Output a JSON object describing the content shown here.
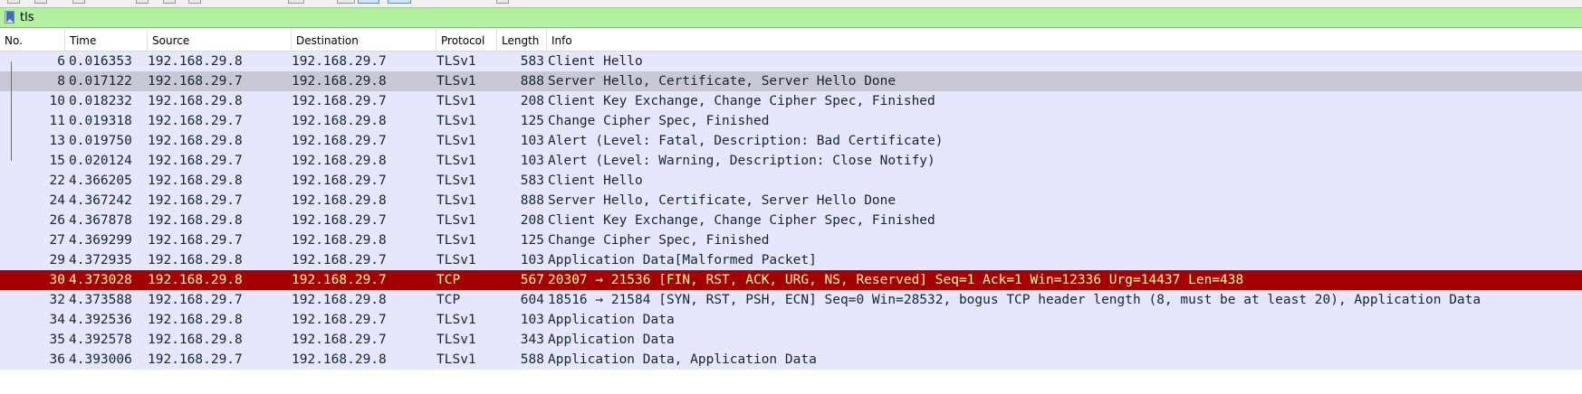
{
  "filter": {
    "value": "tls"
  },
  "columns": {
    "no": "No.",
    "time": "Time",
    "source": "Source",
    "destination": "Destination",
    "protocol": "Protocol",
    "length": "Length",
    "info": "Info"
  },
  "packets": [
    {
      "no": "6",
      "time": "0.016353",
      "source": "192.168.29.8",
      "destination": "192.168.29.7",
      "protocol": "TLSv1",
      "length": "583",
      "info": "Client Hello"
    },
    {
      "no": "8",
      "time": "0.017122",
      "source": "192.168.29.7",
      "destination": "192.168.29.8",
      "protocol": "TLSv1",
      "length": "888",
      "info": "Server Hello, Certificate, Server Hello Done"
    },
    {
      "no": "10",
      "time": "0.018232",
      "source": "192.168.29.8",
      "destination": "192.168.29.7",
      "protocol": "TLSv1",
      "length": "208",
      "info": "Client Key Exchange, Change Cipher Spec, Finished"
    },
    {
      "no": "11",
      "time": "0.019318",
      "source": "192.168.29.7",
      "destination": "192.168.29.8",
      "protocol": "TLSv1",
      "length": "125",
      "info": "Change Cipher Spec, Finished"
    },
    {
      "no": "13",
      "time": "0.019750",
      "source": "192.168.29.8",
      "destination": "192.168.29.7",
      "protocol": "TLSv1",
      "length": "103",
      "info": "Alert (Level: Fatal, Description: Bad Certificate)"
    },
    {
      "no": "15",
      "time": "0.020124",
      "source": "192.168.29.7",
      "destination": "192.168.29.8",
      "protocol": "TLSv1",
      "length": "103",
      "info": "Alert (Level: Warning, Description: Close Notify)"
    },
    {
      "no": "22",
      "time": "4.366205",
      "source": "192.168.29.8",
      "destination": "192.168.29.7",
      "protocol": "TLSv1",
      "length": "583",
      "info": "Client Hello"
    },
    {
      "no": "24",
      "time": "4.367242",
      "source": "192.168.29.7",
      "destination": "192.168.29.8",
      "protocol": "TLSv1",
      "length": "888",
      "info": "Server Hello, Certificate, Server Hello Done"
    },
    {
      "no": "26",
      "time": "4.367878",
      "source": "192.168.29.8",
      "destination": "192.168.29.7",
      "protocol": "TLSv1",
      "length": "208",
      "info": "Client Key Exchange, Change Cipher Spec, Finished"
    },
    {
      "no": "27",
      "time": "4.369299",
      "source": "192.168.29.7",
      "destination": "192.168.29.8",
      "protocol": "TLSv1",
      "length": "125",
      "info": "Change Cipher Spec, Finished"
    },
    {
      "no": "29",
      "time": "4.372935",
      "source": "192.168.29.8",
      "destination": "192.168.29.7",
      "protocol": "TLSv1",
      "length": "103",
      "info": "Application Data[Malformed Packet]"
    },
    {
      "no": "30",
      "time": "4.373028",
      "source": "192.168.29.8",
      "destination": "192.168.29.7",
      "protocol": "TCP",
      "length": "567",
      "info": "20307 → 21536 [FIN, RST, ACK, URG, NS, Reserved] Seq=1 Ack=1 Win=12336 Urg=14437 Len=438"
    },
    {
      "no": "32",
      "time": "4.373588",
      "source": "192.168.29.7",
      "destination": "192.168.29.8",
      "protocol": "TCP",
      "length": "604",
      "info": "18516 → 21584 [SYN, RST, PSH, ECN] Seq=0 Win=28532, bogus TCP header length (8, must be at least 20), Application Data"
    },
    {
      "no": "34",
      "time": "4.392536",
      "source": "192.168.29.8",
      "destination": "192.168.29.7",
      "protocol": "TLSv1",
      "length": "103",
      "info": "Application Data"
    },
    {
      "no": "35",
      "time": "4.392578",
      "source": "192.168.29.8",
      "destination": "192.168.29.7",
      "protocol": "TLSv1",
      "length": "343",
      "info": "Application Data"
    },
    {
      "no": "36",
      "time": "4.393006",
      "source": "192.168.29.7",
      "destination": "192.168.29.8",
      "protocol": "TLSv1",
      "length": "588",
      "info": "Application Data, Application Data"
    }
  ],
  "styles": {
    "row_default_bg": "#e7e6ff",
    "row_selected_bg": "#c8c8d6",
    "row_error_bg": "#a40000",
    "row_error_fg": "#fffc9c",
    "filter_valid_bg": "#b1f1a0"
  },
  "selected_index": 1,
  "error_indices": [
    11
  ],
  "related_range": [
    0,
    5
  ]
}
